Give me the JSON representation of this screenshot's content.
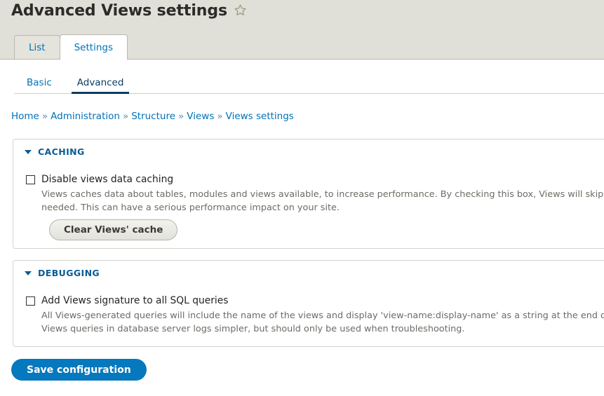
{
  "header": {
    "title": "Advanced Views settings",
    "star_icon": "star-outline-icon"
  },
  "primary_tabs": [
    {
      "label": "List",
      "active": false
    },
    {
      "label": "Settings",
      "active": true
    }
  ],
  "secondary_tabs": [
    {
      "label": "Basic",
      "active": false
    },
    {
      "label": "Advanced",
      "active": true
    }
  ],
  "breadcrumb": {
    "separator": "»",
    "items": [
      "Home",
      "Administration",
      "Structure",
      "Views",
      "Views settings"
    ]
  },
  "sections": {
    "caching": {
      "legend": "CACHING",
      "checkbox_label": "Disable views data caching",
      "checked": false,
      "description": "Views caches data about tables, modules and views available, to increase performance. By checking this box, Views will skip this cache and always rebuild this data when needed. This can have a serious performance impact on your site.",
      "button_label": "Clear Views' cache"
    },
    "debugging": {
      "legend": "DEBUGGING",
      "checkbox_label": "Add Views signature to all SQL queries",
      "checked": false,
      "description": "All Views-generated queries will include the name of the views and display 'view-name:display-name' as a string at the end of the SELECT clause. This makes identifying Views queries in database server logs simpler, but should only be used when troubleshooting."
    }
  },
  "actions": {
    "save_label": "Save configuration"
  },
  "colors": {
    "header_background": "#e0e0d8",
    "link": "#0071b8",
    "active_tab_text": "#0b3d63",
    "legend": "#0b5c92",
    "primary_button": "#0678be",
    "description_text": "#6b6b66"
  }
}
